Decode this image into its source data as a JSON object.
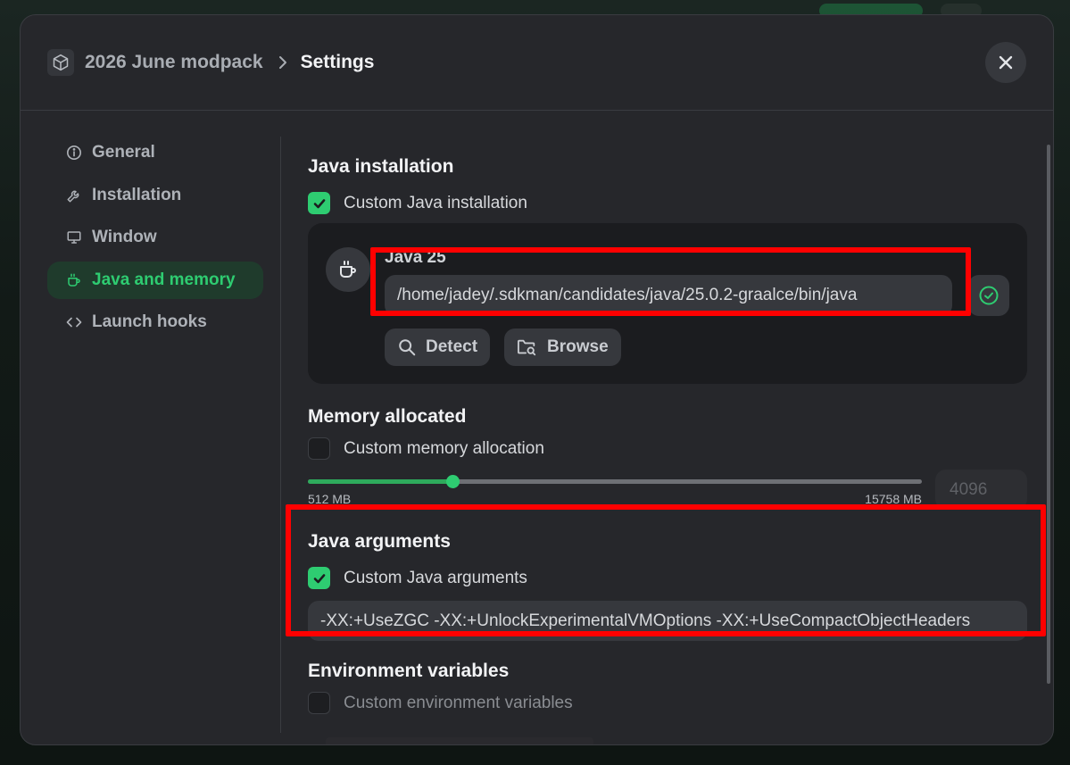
{
  "header": {
    "parent": "2026 June modpack",
    "current": "Settings",
    "parent_icon": "package-icon",
    "close_icon": "close-icon"
  },
  "sidebar": {
    "items": [
      {
        "label": "General",
        "icon": "info-icon",
        "active": false
      },
      {
        "label": "Installation",
        "icon": "wrench-icon",
        "active": false
      },
      {
        "label": "Window",
        "icon": "monitor-icon",
        "active": false
      },
      {
        "label": "Java and memory",
        "icon": "coffee-icon",
        "active": true
      },
      {
        "label": "Launch hooks",
        "icon": "code-icon",
        "active": false
      }
    ]
  },
  "java_installation": {
    "title": "Java installation",
    "checkbox_label": "Custom Java installation",
    "checked": true,
    "version": "Java 25",
    "path": "/home/jadey/.sdkman/candidates/java/25.0.2-graalce/bin/java",
    "detect_label": "Detect",
    "browse_label": "Browse"
  },
  "memory": {
    "title": "Memory allocated",
    "checkbox_label": "Custom memory allocation",
    "checked": false,
    "min_label": "512 MB",
    "max_label": "15758 MB",
    "min": 512,
    "max": 15758,
    "value": 4096,
    "value_display": "4096"
  },
  "java_arguments": {
    "title": "Java arguments",
    "checkbox_label": "Custom Java arguments",
    "checked": true,
    "value": "-XX:+UseZGC -XX:+UnlockExperimentalVMOptions -XX:+UseCompactObjectHeaders"
  },
  "env_vars": {
    "title": "Environment variables",
    "checkbox_label": "Custom environment variables",
    "checked": false
  },
  "colors": {
    "accent": "#2ecc71",
    "highlight": "#ff0000",
    "modal_bg": "#26272b"
  }
}
